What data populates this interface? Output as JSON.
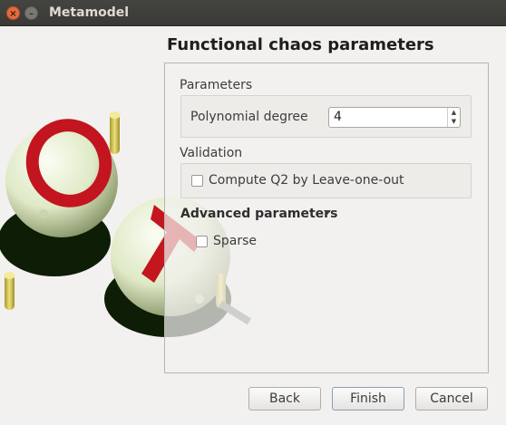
{
  "window": {
    "title": "Metamodel"
  },
  "wizard": {
    "title": "Functional chaos parameters"
  },
  "parameters": {
    "section_label": "Parameters",
    "polynomial_degree_label": "Polynomial degree",
    "polynomial_degree_value": "4"
  },
  "validation": {
    "section_label": "Validation",
    "leave_one_out_label": "Compute Q2 by Leave-one-out"
  },
  "advanced": {
    "section_label": "Advanced parameters",
    "sparse_label": "Sparse"
  },
  "buttons": {
    "back": "Back",
    "finish": "Finish",
    "cancel": "Cancel"
  }
}
